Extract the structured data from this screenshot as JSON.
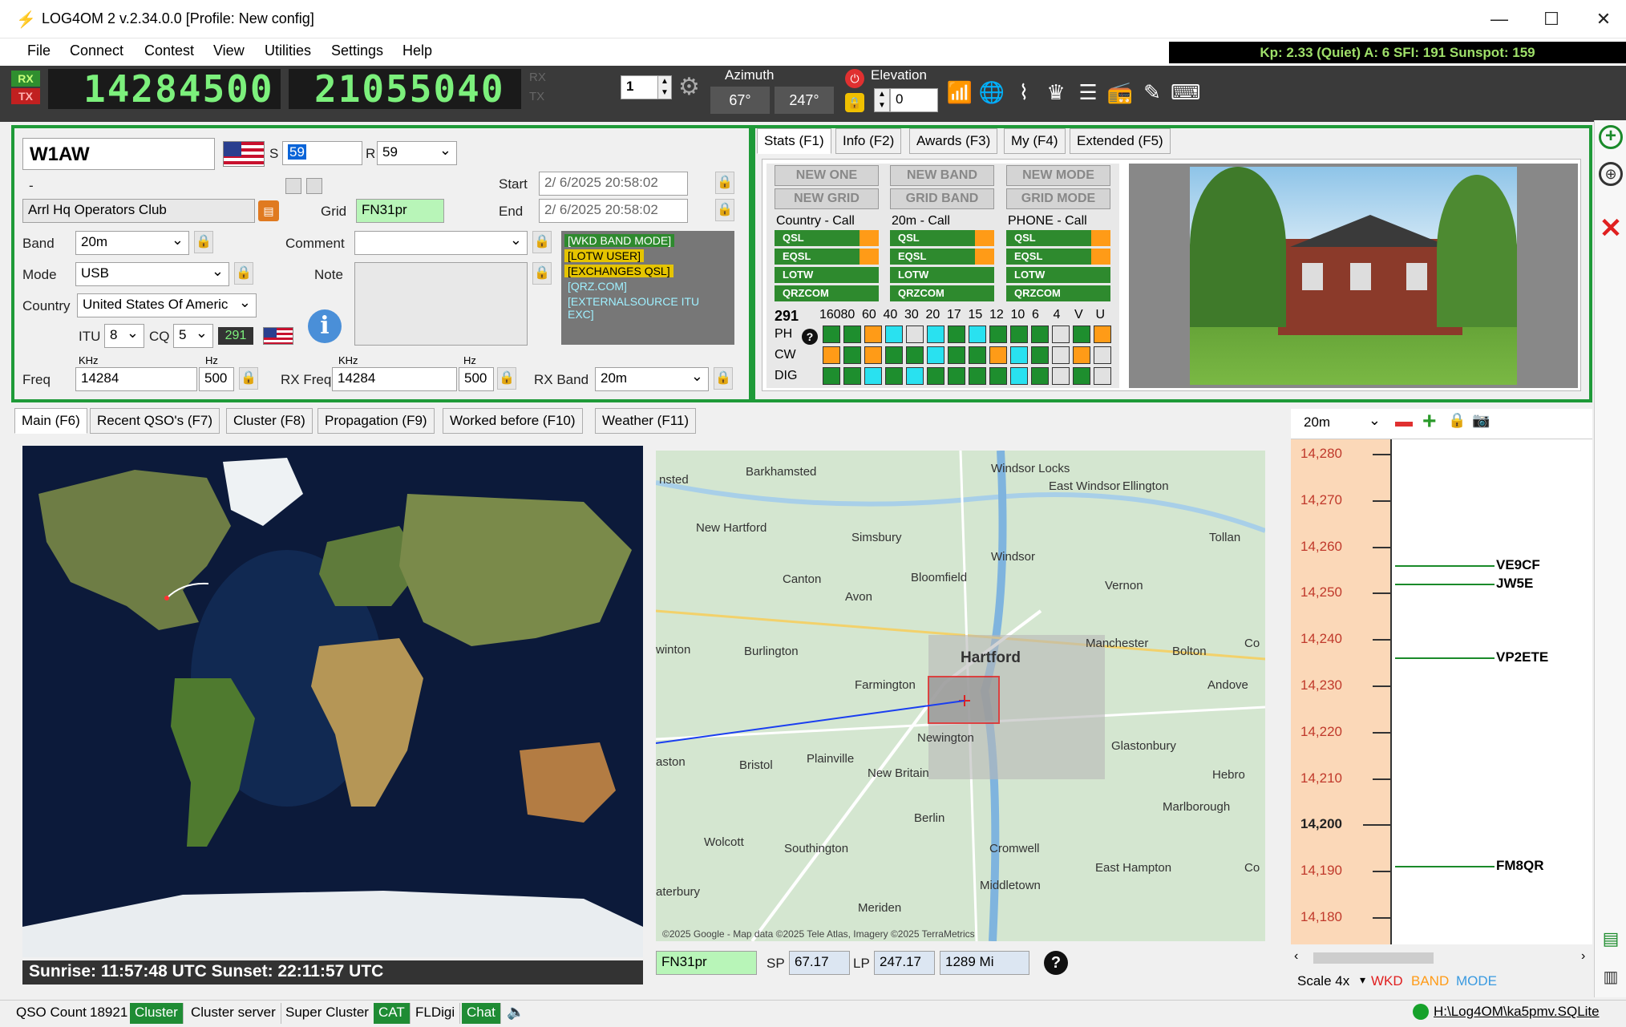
{
  "window": {
    "title": "LOG4OM 2 v.2.34.0.0 [Profile: New config]",
    "minimize": "—",
    "maximize": "☐",
    "close": "✕"
  },
  "menu": [
    "File",
    "Connect",
    "Contest",
    "View",
    "Utilities",
    "Settings",
    "Help"
  ],
  "spaceweather": "Kp: 2.33 (Quiet)  A: 6  SFI: 191  Sunspot: 159",
  "radio": {
    "rx_label": "RX",
    "tx_label": "TX",
    "freq_main": "14284500",
    "freq_sub": "21055040",
    "rx_small": "RX",
    "tx_small": "TX",
    "vfo_num": "1",
    "azimuth_label": "Azimuth",
    "azimuth_sp": "67°",
    "azimuth_lp": "247°",
    "elevation_label": "Elevation",
    "elevation_value": "0"
  },
  "qso": {
    "callsign": "W1AW",
    "s_label": "S",
    "s_value": "59",
    "r_label": "R",
    "r_value": "59",
    "dash": "-",
    "name": "Arrl Hq Operators Club",
    "grid_label": "Grid",
    "grid": "FN31pr",
    "start_label": "Start",
    "start": "2/  6/2025 20:58:02",
    "end_label": "End",
    "end": "2/  6/2025 20:58:02",
    "band_label": "Band",
    "band": "20m",
    "comment_label": "Comment",
    "comment": "",
    "mode_label": "Mode",
    "mode": "USB",
    "note_label": "Note",
    "country_label": "Country",
    "country": "United States Of Americ",
    "itu_label": "ITU",
    "itu": "8",
    "cq_label": "CQ",
    "cq": "5",
    "dxcc": "291",
    "khz_label": "KHz",
    "hz_label": "Hz",
    "freq_label": "Freq",
    "freq": "14284",
    "freq_hz": "500",
    "rxfreq_label": "RX Freq",
    "rxfreq": "14284",
    "rxfreq_hz": "500",
    "rxband_label": "RX Band",
    "rxband": "20m",
    "info_icon": "i"
  },
  "wkd_tags": [
    "[WKD BAND MODE]",
    "[LOTW USER]",
    "[EXCHANGES QSL]",
    "[QRZ.COM]",
    "[EXTERNALSOURCE ITU EXC]"
  ],
  "stats": {
    "tabs": [
      "Stats (F1)",
      "Info (F2)",
      "Awards (F3)",
      "My (F4)",
      "Extended (F5)"
    ],
    "buttons": [
      "NEW ONE",
      "NEW BAND",
      "NEW MODE",
      "NEW GRID",
      "GRID BAND",
      "GRID MODE"
    ],
    "col_titles": [
      "Country - Call",
      "20m - Call",
      "PHONE - Call"
    ],
    "services": [
      "QSL",
      "EQSL",
      "LOTW",
      "QRZCOM"
    ],
    "dxcc": "291",
    "bands": [
      "160",
      "80",
      "60",
      "40",
      "30",
      "20",
      "17",
      "15",
      "12",
      "10",
      "6",
      "4",
      "V",
      "U"
    ],
    "rows": [
      {
        "label": "PH",
        "colors": [
          "g",
          "g",
          "o",
          "c",
          "w",
          "c",
          "g",
          "c",
          "g",
          "g",
          "g",
          "w",
          "g",
          "o"
        ]
      },
      {
        "label": "CW",
        "colors": [
          "o",
          "g",
          "o",
          "g",
          "g",
          "c",
          "g",
          "g",
          "o",
          "c",
          "g",
          "w",
          "o",
          "w"
        ]
      },
      {
        "label": "DIG",
        "colors": [
          "g",
          "g",
          "c",
          "g",
          "c",
          "g",
          "g",
          "g",
          "g",
          "c",
          "g",
          "w",
          "g",
          "w"
        ]
      }
    ],
    "help": "?"
  },
  "bottom_tabs": [
    "Main (F6)",
    "Recent QSO's (F7)",
    "Cluster (F8)",
    "Propagation (F9)",
    "Worked before (F10)",
    "Weather (F11)"
  ],
  "sun": {
    "text": "Sunrise: 11:57:48 UTC  Sunset: 22:11:57 UTC"
  },
  "map": {
    "labels": [
      "nsted",
      "Barkhamsted",
      "Windsor Locks",
      "East Windsor",
      "Ellington",
      "New Hartford",
      "Simsbury",
      "Windsor",
      "Tollan",
      "Canton",
      "Bloomfield",
      "Vernon",
      "Avon",
      "Hartford",
      "Manchester",
      "Bolton",
      "winton",
      "Burlington",
      "Farmington",
      "Andove",
      "Newington",
      "Glastonbury",
      "aston",
      "Bristol",
      "Plainville",
      "New Britain",
      "Hebro",
      "Marlborough",
      "Berlin",
      "Wolcott",
      "Southington",
      "Cromwell",
      "East Hampton",
      "Middletown",
      "aterbury",
      "Meriden",
      "Co",
      "Co"
    ],
    "attribution": "©2025 Google - Map data ©2025 Tele Atlas, Imagery ©2025 TerraMetrics",
    "grid": "FN31pr",
    "sp_label": "SP",
    "sp": "67.17",
    "lp_label": "LP",
    "lp": "247.17",
    "distance": "1289 Mi",
    "help": "?"
  },
  "bandmap": {
    "band": "20m",
    "ticks": [
      "14,280",
      "14,270",
      "14,260",
      "14,250",
      "14,240",
      "14,230",
      "14,220",
      "14,210",
      "14,200",
      "14,190",
      "14,180"
    ],
    "spots": [
      "VE9CF",
      "JW5E",
      "VP2ETE",
      "FM8QR"
    ],
    "scale": "Scale 4x",
    "wkd": "WKD",
    "band_lbl": "BAND",
    "mode_lbl": "MODE"
  },
  "status": {
    "qso_count_label": "QSO Count",
    "qso_count": "18921",
    "cluster": "Cluster",
    "cluster_server": "Cluster server",
    "super_cluster": "Super Cluster",
    "cat": "CAT",
    "fldigi": "FLDigi",
    "chat": "Chat",
    "db": "H:\\Log4OM\\ka5pmv.SQLite"
  }
}
